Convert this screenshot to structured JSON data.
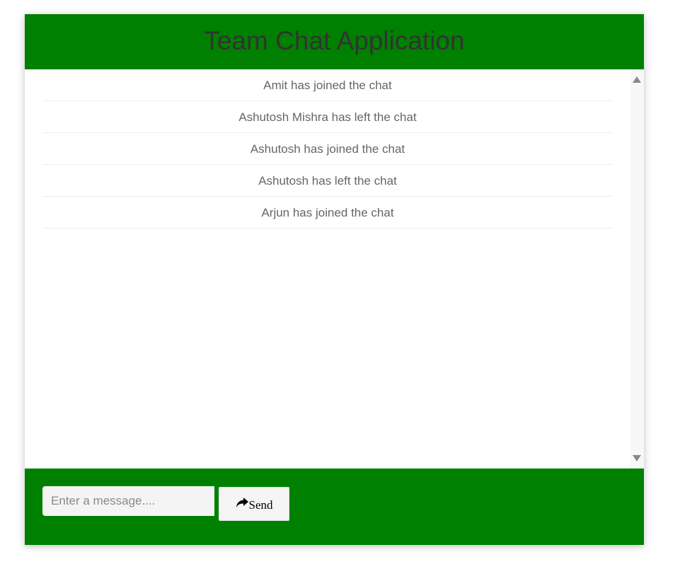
{
  "header": {
    "title": "Team Chat Application"
  },
  "messages": [
    "Amit has joined the chat",
    "Ashutosh Mishra has left the chat",
    "Ashutosh has joined the chat",
    "Ashutosh has left the chat",
    "Arjun has joined the chat"
  ],
  "composer": {
    "placeholder": "Enter a message....",
    "value": "",
    "send_label": "Send",
    "send_icon": "share-arrow-icon"
  },
  "colors": {
    "header_bg": "#008000",
    "footer_bg": "#008000",
    "title_text": "#333333",
    "message_text": "#666666"
  }
}
